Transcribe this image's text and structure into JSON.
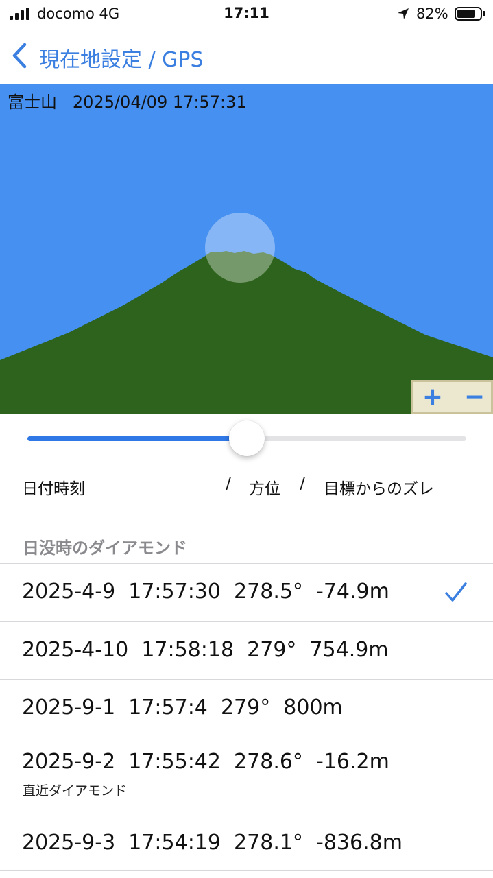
{
  "status_bar": {
    "carrier": "docomo   4G",
    "time": "17:11",
    "battery_percent": "82%",
    "battery_level": 0.82
  },
  "nav": {
    "title": "現在地設定 / GPS"
  },
  "view": {
    "caption": "富士山   2025/04/09 17:57:31",
    "sky_color": "#4590f0",
    "mountain_color": "#2d631d",
    "zoom_in_label": "+",
    "zoom_out_label": "−"
  },
  "slider": {
    "value": 0.5
  },
  "columns": {
    "datetime": "日付時刻",
    "sep1": "/",
    "azimuth": "方位",
    "sep2": "/",
    "offset": "目標からのズレ"
  },
  "section": {
    "title": "日没時のダイアモンド"
  },
  "rows": [
    {
      "text": "2025-4-9  17:57:30  278.5°  -74.9m",
      "note": "",
      "checked": true
    },
    {
      "text": "2025-4-10  17:58:18  279°  754.9m",
      "note": "",
      "checked": false
    },
    {
      "text": "2025-9-1  17:57:4  279°  800m",
      "note": "",
      "checked": false
    },
    {
      "text": "2025-9-2  17:55:42  278.6°  -16.2m",
      "note": "直近ダイアモンド",
      "checked": false
    },
    {
      "text": "2025-9-3  17:54:19  278.1°  -836.8m",
      "note": "",
      "checked": false
    }
  ],
  "colors": {
    "accent": "#3b7fe0",
    "section_gray": "#8a8a8e"
  }
}
